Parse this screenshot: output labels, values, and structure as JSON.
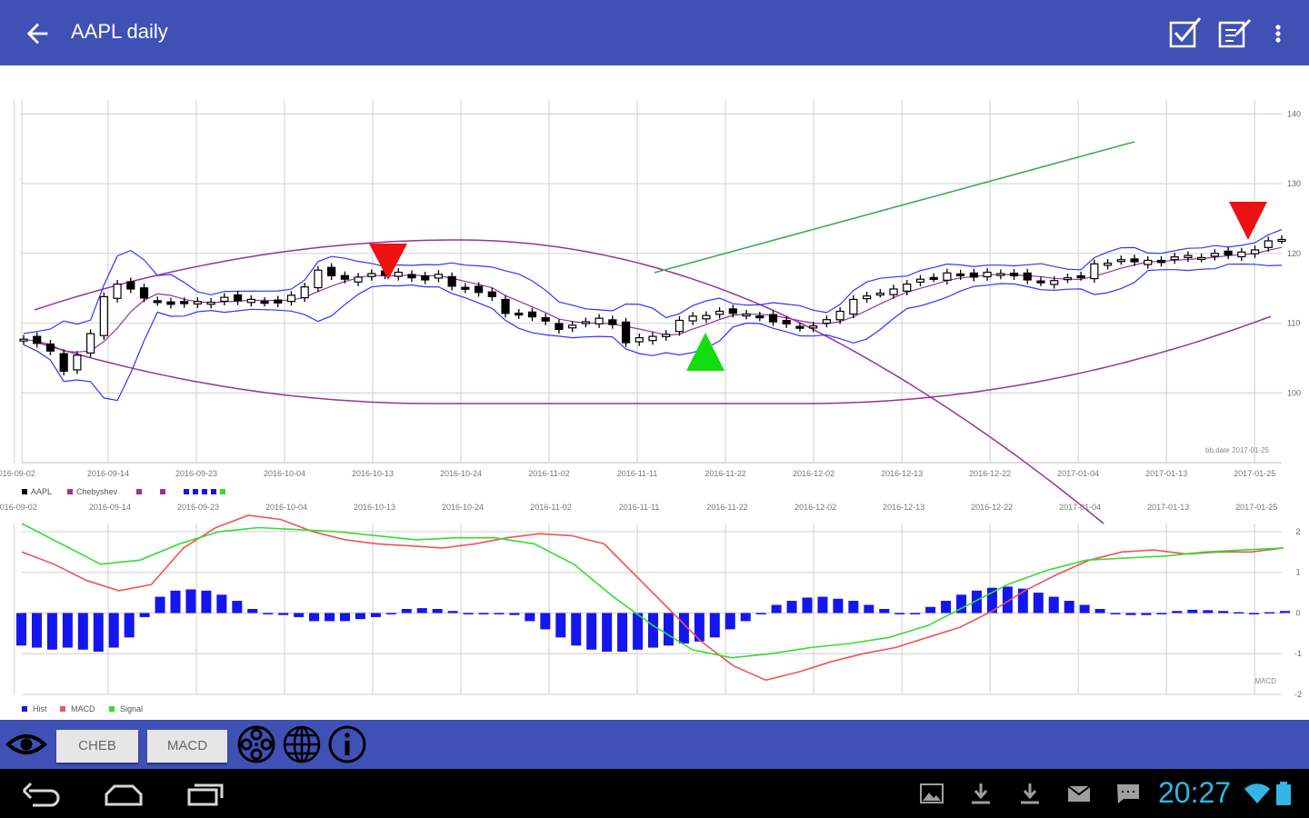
{
  "app_bar": {
    "title": "AAPL daily",
    "back_icon": "arrow-left-icon",
    "actions": [
      "checkbox-edit-icon",
      "edit-note-icon",
      "more-vert-icon"
    ]
  },
  "toolbar": {
    "eye_icon": "eye-icon",
    "buttons": [
      {
        "label": "CHEB"
      },
      {
        "label": "MACD"
      }
    ],
    "icons": [
      "film-reel-icon",
      "globe-icon",
      "info-icon"
    ]
  },
  "status_bar": {
    "time": "20:27"
  },
  "colors": {
    "app_bar": "#3f51b5",
    "candles": "#000000",
    "bollinger": "#3333ff",
    "chebyshev": "#993399",
    "trendline": "#44aa55",
    "sell_marker": "#ee1111",
    "buy_marker": "#11dd11",
    "hist": "#1515ee",
    "macd": "#ee5555",
    "signal": "#33dd33",
    "clock": "#33b5e5"
  },
  "chart_data": [
    {
      "type": "candlestick",
      "x_ticks": [
        "2016-09-02",
        "2016-09-14",
        "2016-09-23",
        "2016-10-04",
        "2016-10-13",
        "2016-10-24",
        "2016-11-02",
        "2016-11-11",
        "2016-11-22",
        "2016-12-02",
        "2016-12-13",
        "2016-12-22",
        "2017-01-04",
        "2017-01-13",
        "2017-01-25"
      ],
      "y_ticks": [
        100,
        110,
        120,
        130,
        140
      ],
      "ylim": [
        90,
        142
      ],
      "grid": true,
      "annotation": "bb.date 2017-01-25",
      "legend": [
        "AAPL",
        "Chebyshev"
      ],
      "legend_position": "bottom-left",
      "close": [
        107.7,
        107.1,
        106.0,
        103.1,
        105.4,
        108.5,
        113.8,
        115.6,
        114.9,
        113.6,
        113.1,
        112.7,
        112.8,
        113.1,
        113.0,
        113.7,
        113.2,
        113.4,
        113.0,
        112.9,
        114.0,
        115.2,
        117.6,
        116.8,
        116.3,
        116.6,
        117.1,
        116.9,
        117.3,
        116.5,
        116.2,
        117.0,
        115.3,
        114.9,
        114.4,
        113.8,
        111.4,
        111.2,
        110.9,
        110.3,
        109.1,
        109.7,
        110.2,
        110.7,
        109.8,
        107.2,
        107.9,
        108.1,
        108.4,
        110.4,
        111.0,
        111.1,
        111.7,
        111.4,
        111.3,
        110.9,
        110.2,
        109.9,
        109.4,
        109.6,
        110.5,
        111.7,
        113.4,
        113.9,
        114.3,
        114.9,
        115.6,
        116.3,
        116.5,
        117.2,
        116.8,
        116.6,
        117.3,
        117.1,
        116.8,
        116.2,
        115.9,
        116.1,
        116.5,
        116.7,
        118.5,
        118.6,
        119.1,
        118.8,
        119.0,
        118.7,
        119.5,
        119.7,
        119.4,
        120.0,
        119.8,
        120.2,
        120.5,
        121.8,
        122.0
      ],
      "buy_signals": [
        "2016-11-17"
      ],
      "sell_signals": [
        "2016-10-13",
        "2017-01-23"
      ]
    },
    {
      "type": "line",
      "title": "MACD",
      "x_ticks": [
        "2016-09-02",
        "2016-09-14",
        "2016-09-23",
        "2016-10-04",
        "2016-10-13",
        "2016-10-24",
        "2016-11-02",
        "2016-11-11",
        "2016-11-22",
        "2016-12-02",
        "2016-12-13",
        "2016-12-22",
        "2017-01-04",
        "2017-01-13",
        "2017-01-25"
      ],
      "y_ticks": [
        -2,
        -1,
        0,
        1,
        2
      ],
      "ylim": [
        -2,
        2.2
      ],
      "grid": true,
      "legend": [
        "Hist",
        "MACD",
        "Signal"
      ],
      "legend_position": "bottom-left",
      "macd": [
        1.5,
        1.2,
        0.8,
        0.55,
        0.7,
        1.6,
        2.1,
        2.4,
        2.3,
        2.0,
        1.8,
        1.7,
        1.65,
        1.6,
        1.7,
        1.85,
        1.95,
        1.9,
        1.7,
        0.9,
        0.1,
        -0.7,
        -1.3,
        -1.65,
        -1.45,
        -1.2,
        -1.0,
        -0.85,
        -0.6,
        -0.35,
        0.05,
        0.55,
        0.95,
        1.3,
        1.5,
        1.55,
        1.45,
        1.5,
        1.5,
        1.6
      ],
      "signal": [
        2.2,
        1.7,
        1.2,
        1.3,
        1.7,
        2.0,
        2.1,
        2.05,
        2.0,
        1.9,
        1.8,
        1.85,
        1.85,
        1.7,
        1.2,
        0.4,
        -0.3,
        -0.9,
        -1.1,
        -1.0,
        -0.85,
        -0.75,
        -0.6,
        -0.3,
        0.2,
        0.7,
        1.05,
        1.3,
        1.35,
        1.4,
        1.5,
        1.55,
        1.6
      ],
      "hist": [
        -0.8,
        -0.85,
        -0.9,
        -0.85,
        -0.9,
        -0.95,
        -0.85,
        -0.6,
        -0.1,
        0.4,
        0.55,
        0.58,
        0.55,
        0.45,
        0.3,
        0.1,
        0.0,
        -0.05,
        -0.1,
        -0.2,
        -0.2,
        -0.2,
        -0.15,
        -0.1,
        0.0,
        0.1,
        0.12,
        0.1,
        0.05,
        0.0,
        0.0,
        0.0,
        -0.05,
        -0.2,
        -0.4,
        -0.6,
        -0.8,
        -0.9,
        -0.95,
        -0.95,
        -0.9,
        -0.85,
        -0.8,
        -0.75,
        -0.7,
        -0.6,
        -0.4,
        -0.2,
        0.0,
        0.2,
        0.3,
        0.38,
        0.4,
        0.35,
        0.3,
        0.2,
        0.1,
        0.0,
        0.0,
        0.15,
        0.3,
        0.45,
        0.55,
        0.62,
        0.65,
        0.6,
        0.5,
        0.4,
        0.3,
        0.2,
        0.1,
        0.0,
        -0.05,
        -0.05,
        0.0,
        0.05,
        0.08,
        0.07,
        0.05,
        0.02,
        0.0,
        0.02,
        0.05
      ]
    }
  ]
}
